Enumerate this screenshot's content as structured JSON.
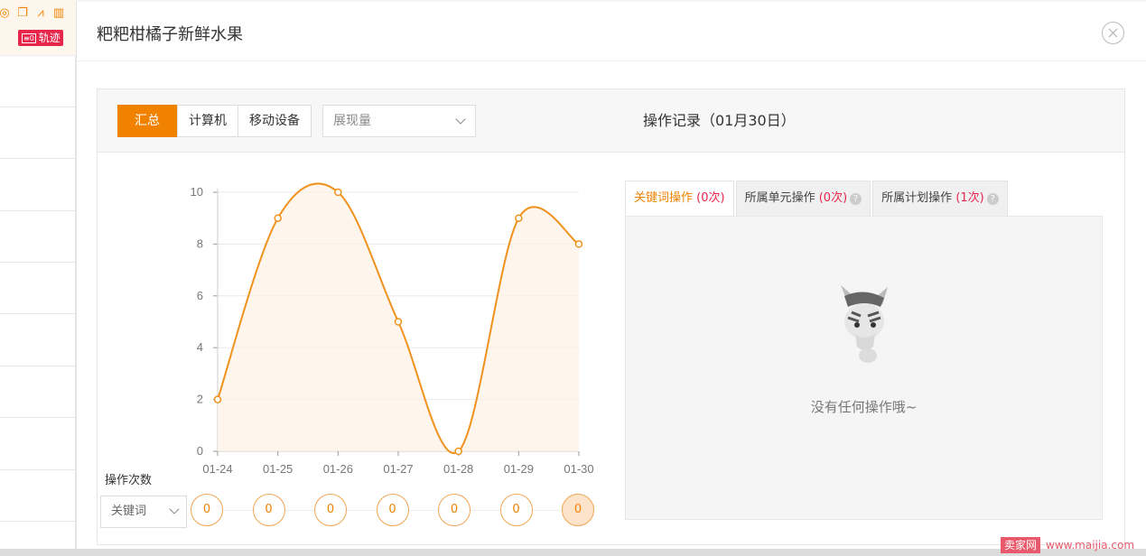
{
  "background": {
    "track_badge_icon": "track-icon",
    "track_badge_label": "轨迹",
    "toolbar_icons": [
      "target-icon",
      "copy-icon",
      "chart-icon",
      "trash-icon"
    ]
  },
  "modal": {
    "title": "粑粑柑橘子新鲜水果",
    "close_icon": "close-icon"
  },
  "filters": {
    "device_tabs": [
      "汇总",
      "计算机",
      "移动设备"
    ],
    "active_device": "汇总",
    "metric_select": "展现量"
  },
  "log": {
    "title": "操作记录（01月30日）",
    "tabs": [
      {
        "label": "关键词操作",
        "count": "(0次)",
        "help": false
      },
      {
        "label": "所属单元操作",
        "count": "(0次)",
        "help": true
      },
      {
        "label": "所属计划操作",
        "count": "(1次)",
        "help": true
      }
    ],
    "empty_text": "没有任何操作哦~"
  },
  "ops": {
    "label": "操作次数",
    "type_select": "关键词",
    "counts": [
      "0",
      "0",
      "0",
      "0",
      "0",
      "0",
      "0"
    ],
    "selected_index": 6
  },
  "chart_data": {
    "type": "line",
    "categories": [
      "01-24",
      "01-25",
      "01-26",
      "01-27",
      "01-28",
      "01-29",
      "01-30"
    ],
    "values": [
      2,
      9,
      10,
      5,
      0,
      9,
      8
    ],
    "ylim": [
      0,
      10
    ],
    "yticks": [
      0,
      2,
      4,
      6,
      8,
      10
    ],
    "smooth": true,
    "area_fill": true,
    "color": "#f0921e",
    "grid": true
  },
  "watermark": {
    "logo": "卖家网",
    "url": "www.maijia.com"
  },
  "colors": {
    "accent": "#f08200",
    "count_red": "#e8254a"
  }
}
